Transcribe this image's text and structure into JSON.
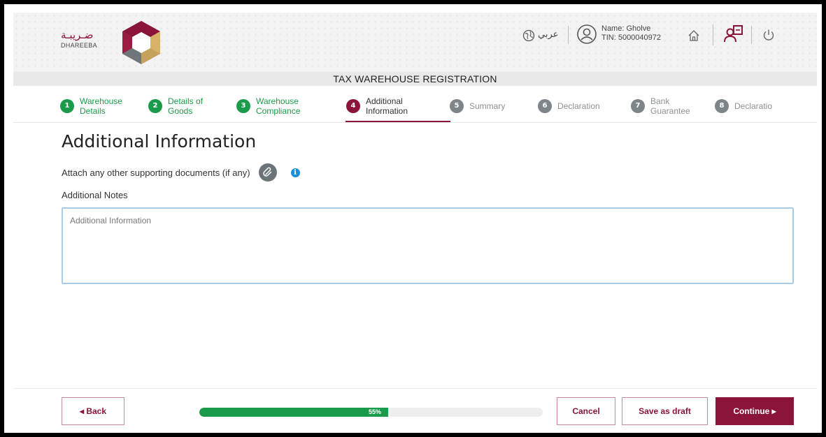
{
  "brand": {
    "arabic_name": "ضـريبـة",
    "english_name": "DHAREEBA"
  },
  "header": {
    "language_label": "عربي",
    "user_name": "Name: Gholve",
    "user_tin": "TIN: 5000040972",
    "icons": [
      "globe-icon",
      "user-icon",
      "home-icon",
      "switch-account-icon",
      "power-icon"
    ]
  },
  "page_heading": "TAX WAREHOUSE REGISTRATION",
  "steps": [
    {
      "number": "1",
      "label_line1": "Warehouse",
      "label_line2": "Details",
      "state": "done"
    },
    {
      "number": "2",
      "label_line1": "Details of",
      "label_line2": "Goods",
      "state": "done"
    },
    {
      "number": "3",
      "label_line1": "Warehouse",
      "label_line2": "Compliance",
      "state": "done"
    },
    {
      "number": "4",
      "label_line1": "Additional",
      "label_line2": "Information",
      "state": "active"
    },
    {
      "number": "5",
      "label_line1": "Summary",
      "label_line2": "",
      "state": "todo"
    },
    {
      "number": "6",
      "label_line1": "Declaration",
      "label_line2": "",
      "state": "todo"
    },
    {
      "number": "7",
      "label_line1": "Bank",
      "label_line2": "Guarantee",
      "state": "todo"
    },
    {
      "number": "8",
      "label_line1": "Declaratio",
      "label_line2": "",
      "state": "todo"
    }
  ],
  "section": {
    "title": "Additional Information",
    "attach_label": "Attach any other supporting documents (if any)",
    "notes_label": "Additional Notes",
    "notes_placeholder": "Additional Information",
    "notes_value": ""
  },
  "footer": {
    "back_label": "◂  Back",
    "cancel_label": "Cancel",
    "draft_label": "Save as draft",
    "continue_label": "Continue  ▸",
    "progress_percent": 55,
    "progress_text": "55%"
  },
  "colors": {
    "brand": "#8a1538",
    "done": "#1a9b4b",
    "todo": "#7d8589",
    "info": "#1d8fd8"
  }
}
